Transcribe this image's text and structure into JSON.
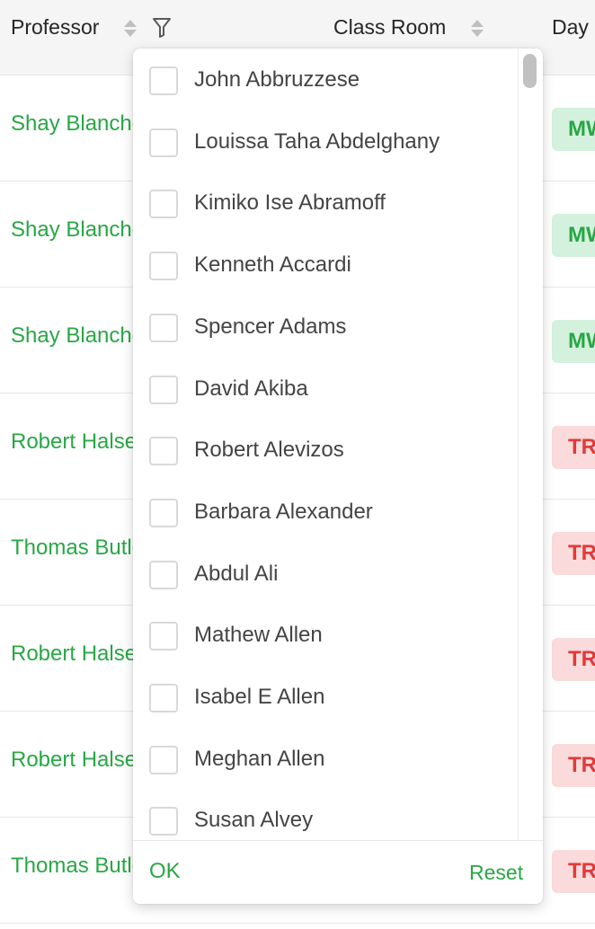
{
  "header": {
    "professor": "Professor",
    "class_room": "Class Room",
    "day": "Day"
  },
  "rows": [
    {
      "professor": "Shay Blanchette",
      "day": "MWF",
      "day_status": "green"
    },
    {
      "professor": "Shay Blanchette",
      "day": "MWF",
      "day_status": "green"
    },
    {
      "professor": "Shay Blanchette",
      "day": "MWF",
      "day_status": "green"
    },
    {
      "professor": "Robert Halsey",
      "day": "TR",
      "day_status": "red"
    },
    {
      "professor": "Thomas Butler",
      "day": "TR",
      "day_status": "red"
    },
    {
      "professor": "Robert Halsey",
      "day": "TR",
      "day_status": "red"
    },
    {
      "professor": "Robert Halsey",
      "day": "TR",
      "day_status": "red"
    },
    {
      "professor": "Thomas Butler",
      "day": "TR",
      "day_status": "red"
    }
  ],
  "filter": {
    "options": [
      {
        "label": "John Abbruzzese",
        "checked": false
      },
      {
        "label": "Louissa Taha Abdelghany",
        "checked": false
      },
      {
        "label": "Kimiko Ise Abramoff",
        "checked": false
      },
      {
        "label": "Kenneth Accardi",
        "checked": false
      },
      {
        "label": "Spencer Adams",
        "checked": false
      },
      {
        "label": "David Akiba",
        "checked": false
      },
      {
        "label": "Robert Alevizos",
        "checked": false
      },
      {
        "label": "Barbara Alexander",
        "checked": false
      },
      {
        "label": "Abdul Ali",
        "checked": false
      },
      {
        "label": "Mathew Allen",
        "checked": false
      },
      {
        "label": "Isabel E Allen",
        "checked": false
      },
      {
        "label": "Meghan Allen",
        "checked": false
      },
      {
        "label": "Susan Alvey",
        "checked": false
      }
    ],
    "ok_label": "OK",
    "reset_label": "Reset"
  },
  "colors": {
    "accent": "#28a745",
    "tag_green_bg": "#d4f1de",
    "tag_red_bg": "#fadada",
    "tag_red_text": "#e03b3b"
  }
}
